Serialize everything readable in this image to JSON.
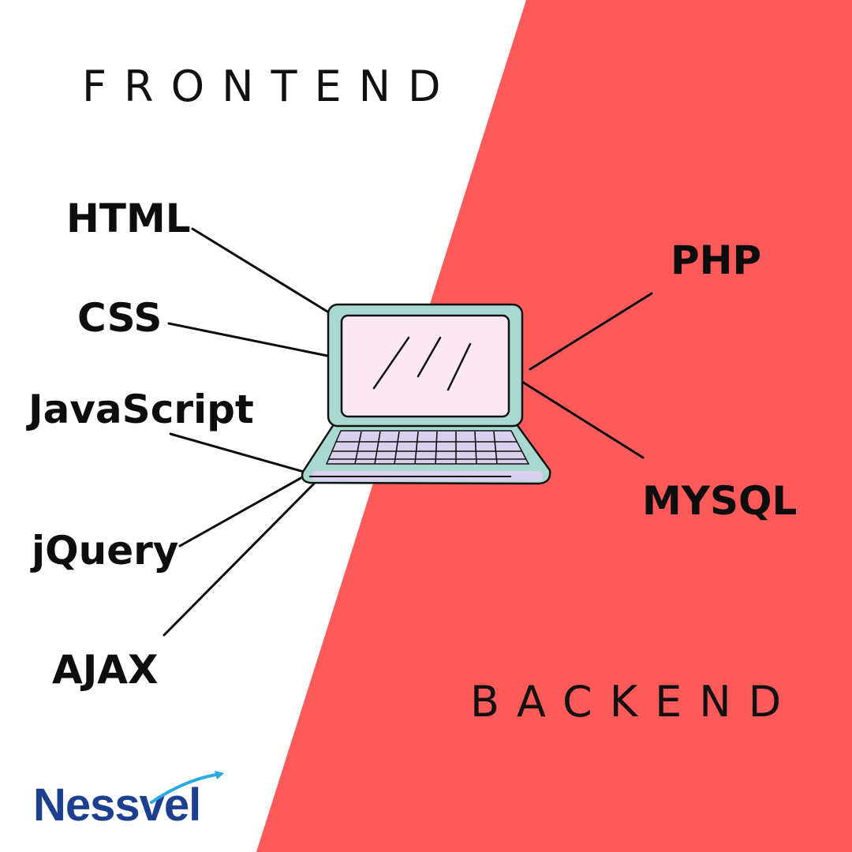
{
  "sections": {
    "frontend": "FRONTEND",
    "backend": "BACKEND"
  },
  "frontend_items": [
    {
      "id": "html",
      "label": "HTML"
    },
    {
      "id": "css",
      "label": "CSS"
    },
    {
      "id": "javascript",
      "label": "JavaScript"
    },
    {
      "id": "jquery",
      "label": "jQuery"
    },
    {
      "id": "ajax",
      "label": "AJAX"
    }
  ],
  "backend_items": [
    {
      "id": "php",
      "label": "PHP"
    },
    {
      "id": "mysql",
      "label": "MYSQL"
    }
  ],
  "logo": {
    "text": "Nessvel"
  },
  "colors": {
    "background": "#ffffff",
    "backend_panel": "#ff5a5a",
    "laptop_frame": "#a8d8d0",
    "laptop_screen": "#fbe8f2",
    "laptop_keyboard": "#d8d0ec",
    "logo_text": "#1d3f8f",
    "logo_swoosh": "#2aa9e0"
  }
}
